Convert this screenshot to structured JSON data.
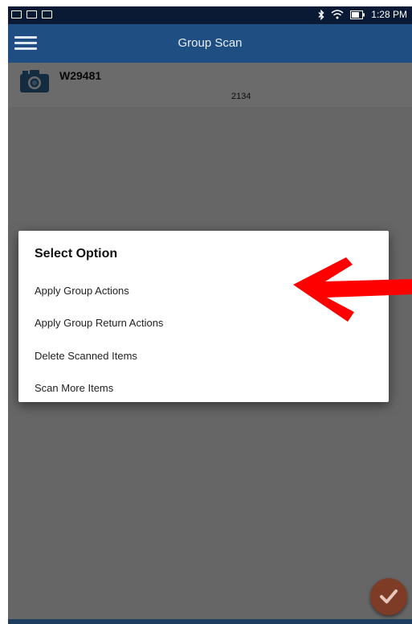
{
  "status_bar": {
    "time": "1:28 PM"
  },
  "app_bar": {
    "title": "Group Scan"
  },
  "list": {
    "items": [
      {
        "id": "W29481",
        "count": "2134"
      }
    ]
  },
  "dialog": {
    "title": "Select Option",
    "options": [
      "Apply Group Actions",
      "Apply Group Return Actions",
      "Delete Scanned Items",
      "Scan More Items"
    ]
  },
  "colors": {
    "status_bar": "#0a1a35",
    "app_bar": "#1e4e82",
    "fab": "#7e3c26",
    "annotation_arrow": "#ff0000"
  },
  "icons": {
    "menu": "hamburger-menu-icon",
    "camera": "camera-icon",
    "fab": "check-icon",
    "annotation": "red-arrow-annotation"
  }
}
